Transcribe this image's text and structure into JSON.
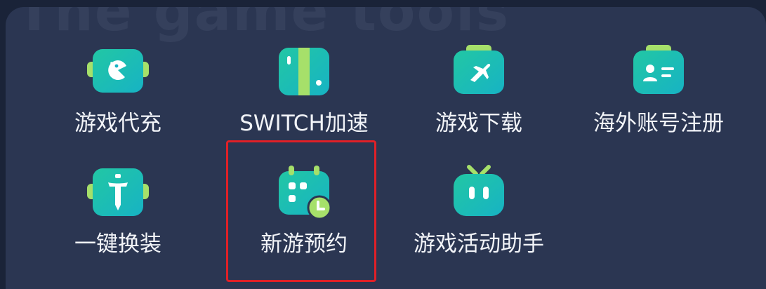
{
  "watermark": "The game tools",
  "colors": {
    "background": "#1a2338",
    "panel": "#2b3652",
    "icon_green": "#12c98a",
    "icon_teal": "#1fc1c8",
    "icon_accent": "#a6e06a",
    "highlight_border": "#e02027",
    "label_text": "#f2f4f8"
  },
  "tools": [
    {
      "label": "游戏代充",
      "icon": "gamepad-pacman-icon"
    },
    {
      "label": "SWITCH加速",
      "icon": "switch-console-icon"
    },
    {
      "label": "游戏下载",
      "icon": "plane-download-icon"
    },
    {
      "label": "海外账号注册",
      "icon": "id-card-icon"
    },
    {
      "label": "一键换装",
      "icon": "sword-outfit-icon"
    },
    {
      "label": "新游预约",
      "icon": "calendar-clock-icon"
    },
    {
      "label": "游戏活动助手",
      "icon": "tv-robot-icon"
    }
  ]
}
